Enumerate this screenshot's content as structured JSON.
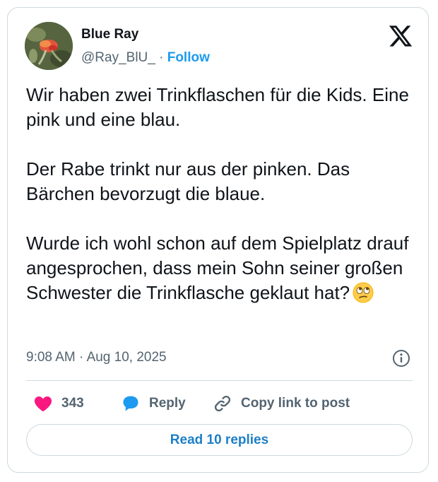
{
  "author": {
    "name": "Blue Ray",
    "handle": "@Ray_BlU_",
    "separator": "·",
    "follow_label": "Follow"
  },
  "tweet": {
    "paragraphs": [
      "Wir haben zwei Trinkflaschen für die Kids. Eine pink und eine blau.",
      "Der Rabe trinkt nur aus der pinken. Das Bärchen bevorzugt die blaue.",
      "Wurde ich wohl schon auf dem Spielplatz drauf angesprochen, dass mein Sohn seiner großen Schwester die Trinkflasche geklaut hat?"
    ],
    "emoji": "face-with-rolling-eyes",
    "time": "9:08 AM",
    "date_separator": "·",
    "date": "Aug 10, 2025"
  },
  "actions": {
    "likes_count": "343",
    "reply_label": "Reply",
    "copy_link_label": "Copy link to post"
  },
  "read_replies_label": "Read 10 replies",
  "icons": {
    "logo": "x-logo-icon",
    "info": "info-icon",
    "like": "heart-icon",
    "reply": "speech-bubble-icon",
    "copy": "link-icon"
  },
  "colors": {
    "accent": "#1d9bf0",
    "like": "#f91880",
    "text": "#0f1419",
    "muted": "#536471",
    "border": "#cfd9de"
  }
}
